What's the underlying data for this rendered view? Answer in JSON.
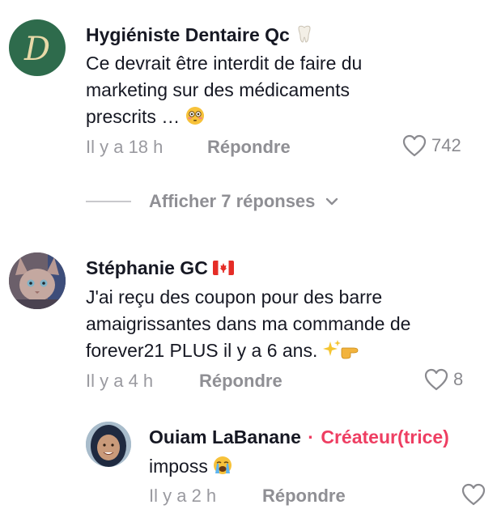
{
  "comments": [
    {
      "author": "Hygiéniste Dentaire Qc",
      "author_badge_icon": "tooth-icon",
      "text_lines": [
        "Ce devrait être interdit de faire du",
        "marketing sur des médicaments",
        "prescrits …"
      ],
      "text_emoji_icon": "flushed-face-emoji",
      "time": "Il y a 18 h",
      "reply_label": "Répondre",
      "likes": "742"
    },
    {
      "author": "Stéphanie GC",
      "author_badge_icon": "canada-flag-icon",
      "text_lines": [
        "J'ai reçu des coupon pour des barre",
        "amaigrissantes dans ma commande de",
        "forever21 PLUS il y a 6 ans."
      ],
      "text_emoji_icon": "sparkles-pointing-emoji",
      "time": "Il y a 4 h",
      "reply_label": "Répondre",
      "likes": "8"
    }
  ],
  "view_replies_label": "Afficher 7 réponses",
  "reply": {
    "author": "Ouiam LaBanane",
    "separator": "·",
    "creator_label": "Créateur(trice)",
    "text": "imposs",
    "text_emoji_icon": "loudly-crying-emoji",
    "time": "Il y a 2 h",
    "reply_label": "Répondre"
  },
  "colors": {
    "accent_pink": "#ee3e62",
    "meta_gray": "#9a9aa0",
    "avatar_green": "#2e6b4c"
  }
}
